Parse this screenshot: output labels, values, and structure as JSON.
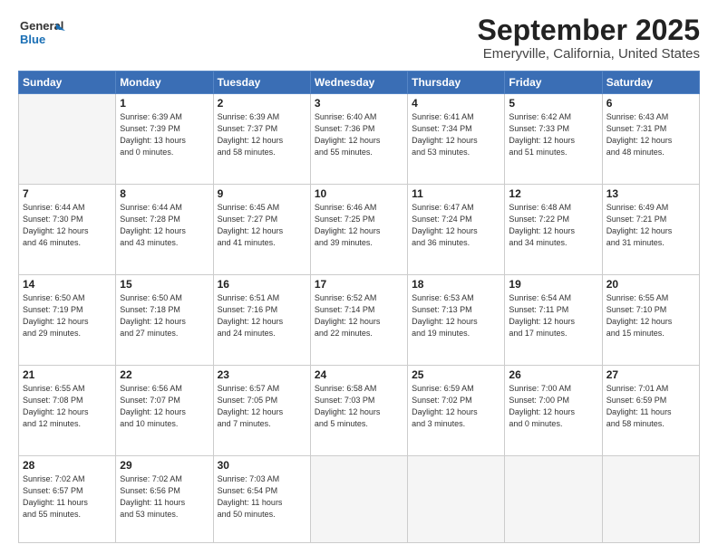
{
  "logo": {
    "line1": "General",
    "line2": "Blue"
  },
  "title": "September 2025",
  "subtitle": "Emeryville, California, United States",
  "days_of_week": [
    "Sunday",
    "Monday",
    "Tuesday",
    "Wednesday",
    "Thursday",
    "Friday",
    "Saturday"
  ],
  "weeks": [
    [
      {
        "day": "",
        "info": ""
      },
      {
        "day": "1",
        "info": "Sunrise: 6:39 AM\nSunset: 7:39 PM\nDaylight: 13 hours\nand 0 minutes."
      },
      {
        "day": "2",
        "info": "Sunrise: 6:39 AM\nSunset: 7:37 PM\nDaylight: 12 hours\nand 58 minutes."
      },
      {
        "day": "3",
        "info": "Sunrise: 6:40 AM\nSunset: 7:36 PM\nDaylight: 12 hours\nand 55 minutes."
      },
      {
        "day": "4",
        "info": "Sunrise: 6:41 AM\nSunset: 7:34 PM\nDaylight: 12 hours\nand 53 minutes."
      },
      {
        "day": "5",
        "info": "Sunrise: 6:42 AM\nSunset: 7:33 PM\nDaylight: 12 hours\nand 51 minutes."
      },
      {
        "day": "6",
        "info": "Sunrise: 6:43 AM\nSunset: 7:31 PM\nDaylight: 12 hours\nand 48 minutes."
      }
    ],
    [
      {
        "day": "7",
        "info": "Sunrise: 6:44 AM\nSunset: 7:30 PM\nDaylight: 12 hours\nand 46 minutes."
      },
      {
        "day": "8",
        "info": "Sunrise: 6:44 AM\nSunset: 7:28 PM\nDaylight: 12 hours\nand 43 minutes."
      },
      {
        "day": "9",
        "info": "Sunrise: 6:45 AM\nSunset: 7:27 PM\nDaylight: 12 hours\nand 41 minutes."
      },
      {
        "day": "10",
        "info": "Sunrise: 6:46 AM\nSunset: 7:25 PM\nDaylight: 12 hours\nand 39 minutes."
      },
      {
        "day": "11",
        "info": "Sunrise: 6:47 AM\nSunset: 7:24 PM\nDaylight: 12 hours\nand 36 minutes."
      },
      {
        "day": "12",
        "info": "Sunrise: 6:48 AM\nSunset: 7:22 PM\nDaylight: 12 hours\nand 34 minutes."
      },
      {
        "day": "13",
        "info": "Sunrise: 6:49 AM\nSunset: 7:21 PM\nDaylight: 12 hours\nand 31 minutes."
      }
    ],
    [
      {
        "day": "14",
        "info": "Sunrise: 6:50 AM\nSunset: 7:19 PM\nDaylight: 12 hours\nand 29 minutes."
      },
      {
        "day": "15",
        "info": "Sunrise: 6:50 AM\nSunset: 7:18 PM\nDaylight: 12 hours\nand 27 minutes."
      },
      {
        "day": "16",
        "info": "Sunrise: 6:51 AM\nSunset: 7:16 PM\nDaylight: 12 hours\nand 24 minutes."
      },
      {
        "day": "17",
        "info": "Sunrise: 6:52 AM\nSunset: 7:14 PM\nDaylight: 12 hours\nand 22 minutes."
      },
      {
        "day": "18",
        "info": "Sunrise: 6:53 AM\nSunset: 7:13 PM\nDaylight: 12 hours\nand 19 minutes."
      },
      {
        "day": "19",
        "info": "Sunrise: 6:54 AM\nSunset: 7:11 PM\nDaylight: 12 hours\nand 17 minutes."
      },
      {
        "day": "20",
        "info": "Sunrise: 6:55 AM\nSunset: 7:10 PM\nDaylight: 12 hours\nand 15 minutes."
      }
    ],
    [
      {
        "day": "21",
        "info": "Sunrise: 6:55 AM\nSunset: 7:08 PM\nDaylight: 12 hours\nand 12 minutes."
      },
      {
        "day": "22",
        "info": "Sunrise: 6:56 AM\nSunset: 7:07 PM\nDaylight: 12 hours\nand 10 minutes."
      },
      {
        "day": "23",
        "info": "Sunrise: 6:57 AM\nSunset: 7:05 PM\nDaylight: 12 hours\nand 7 minutes."
      },
      {
        "day": "24",
        "info": "Sunrise: 6:58 AM\nSunset: 7:03 PM\nDaylight: 12 hours\nand 5 minutes."
      },
      {
        "day": "25",
        "info": "Sunrise: 6:59 AM\nSunset: 7:02 PM\nDaylight: 12 hours\nand 3 minutes."
      },
      {
        "day": "26",
        "info": "Sunrise: 7:00 AM\nSunset: 7:00 PM\nDaylight: 12 hours\nand 0 minutes."
      },
      {
        "day": "27",
        "info": "Sunrise: 7:01 AM\nSunset: 6:59 PM\nDaylight: 11 hours\nand 58 minutes."
      }
    ],
    [
      {
        "day": "28",
        "info": "Sunrise: 7:02 AM\nSunset: 6:57 PM\nDaylight: 11 hours\nand 55 minutes."
      },
      {
        "day": "29",
        "info": "Sunrise: 7:02 AM\nSunset: 6:56 PM\nDaylight: 11 hours\nand 53 minutes."
      },
      {
        "day": "30",
        "info": "Sunrise: 7:03 AM\nSunset: 6:54 PM\nDaylight: 11 hours\nand 50 minutes."
      },
      {
        "day": "",
        "info": ""
      },
      {
        "day": "",
        "info": ""
      },
      {
        "day": "",
        "info": ""
      },
      {
        "day": "",
        "info": ""
      }
    ]
  ]
}
